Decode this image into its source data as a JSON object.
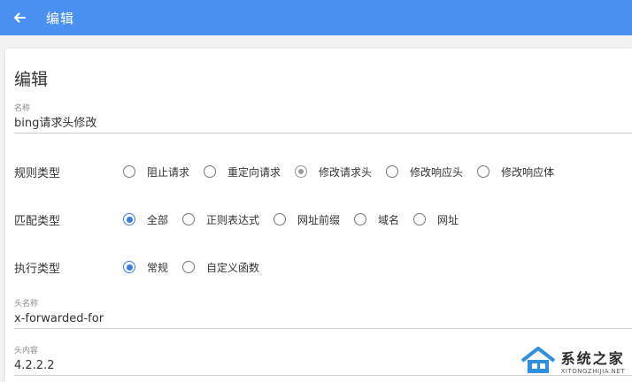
{
  "appbar": {
    "title": "编辑"
  },
  "card": {
    "title": "编辑"
  },
  "name_field": {
    "label": "名称",
    "value": "bing请求头修改"
  },
  "rule_type": {
    "label": "规则类型",
    "options": [
      "阻止请求",
      "重定向请求",
      "修改请求头",
      "修改响应头",
      "修改响应体"
    ]
  },
  "match_type": {
    "label": "匹配类型",
    "options": [
      "全部",
      "正则表达式",
      "网址前缀",
      "域名",
      "网址"
    ]
  },
  "exec_type": {
    "label": "执行类型",
    "options": [
      "常规",
      "自定义函数"
    ]
  },
  "header_name": {
    "label": "头名称",
    "value": "x-forwarded-for"
  },
  "header_value": {
    "label": "头内容",
    "value": "4.2.2.2"
  },
  "watermark": {
    "cn": "系统之家",
    "en": "XITONGZHIJIA.NET"
  },
  "colors": {
    "accent": "#4a90f0",
    "radio_checked": "#3a7be0"
  }
}
